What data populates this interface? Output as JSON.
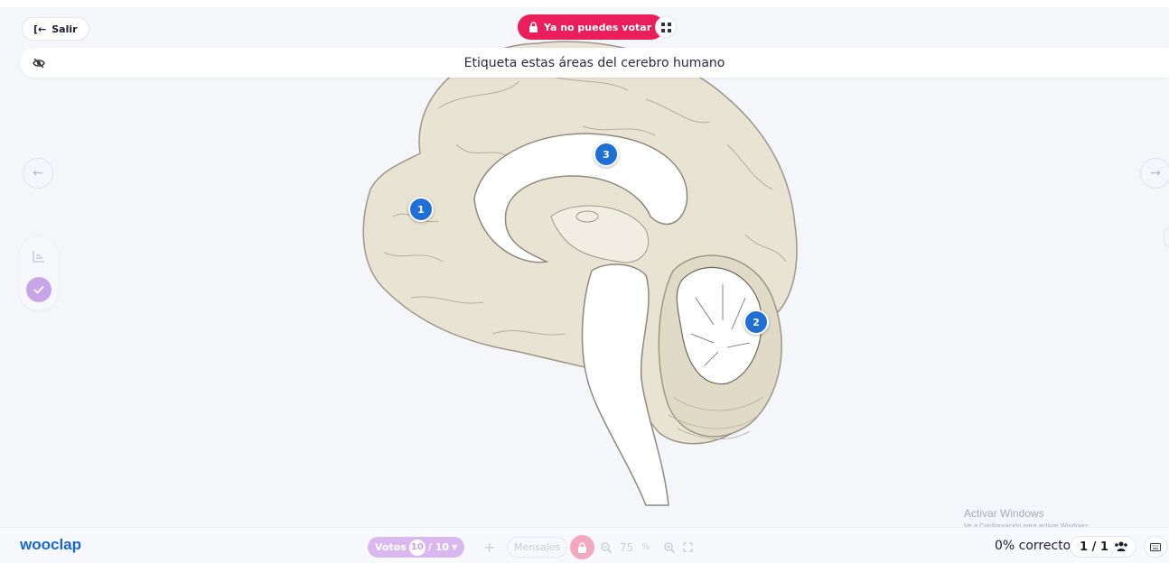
{
  "header": {
    "exit_label": "Salir",
    "vote_status_label": "Ya no puedes votar"
  },
  "question": {
    "title": "Etiqueta estas áreas del cerebro humano"
  },
  "navigation": {
    "prev_icon": "arrow-left-icon",
    "next_icon": "arrow-right-icon"
  },
  "markers": [
    {
      "label": "1"
    },
    {
      "label": "2"
    },
    {
      "label": "3"
    }
  ],
  "watermark": {
    "line1": "Activar Windows",
    "line2": "Ve a Configuración para activar Windows."
  },
  "footer": {
    "logo": "wooclap",
    "votes_label": "Votos",
    "votes_current": "10",
    "votes_total": "/ 10",
    "add_symbol": "+",
    "messages_label": "Mensajes",
    "zoom_value": "75",
    "zoom_unit": "%",
    "correct_text": "0% correcto",
    "participants_text": "1 / 1"
  },
  "colors": {
    "accent_red": "#e91e5a",
    "marker_blue": "#1f6fd6",
    "logo_blue": "#1565d8",
    "check_purple": "#c7a5e6"
  }
}
